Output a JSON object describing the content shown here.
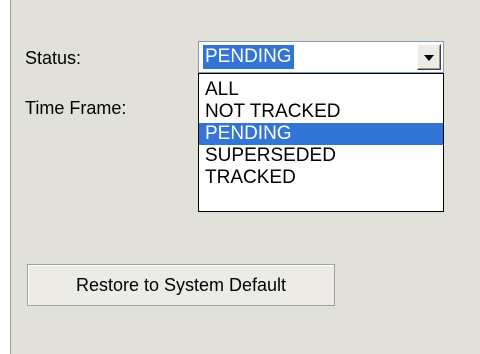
{
  "form": {
    "status_label": "Status:",
    "time_frame_label": "Time Frame:",
    "status_select": {
      "value": "PENDING",
      "options": [
        "ALL",
        "NOT TRACKED",
        "PENDING",
        "SUPERSEDED",
        "TRACKED"
      ],
      "selected_index": 2,
      "dropdown_open": true
    },
    "restore_button_label": "Restore to System Default"
  },
  "colors": {
    "panel_background": "#e1e1d9",
    "selection_highlight": "#3375d6",
    "selection_text": "#ffffff"
  },
  "icons": {
    "dropdown_button": "chevron-down-icon"
  }
}
